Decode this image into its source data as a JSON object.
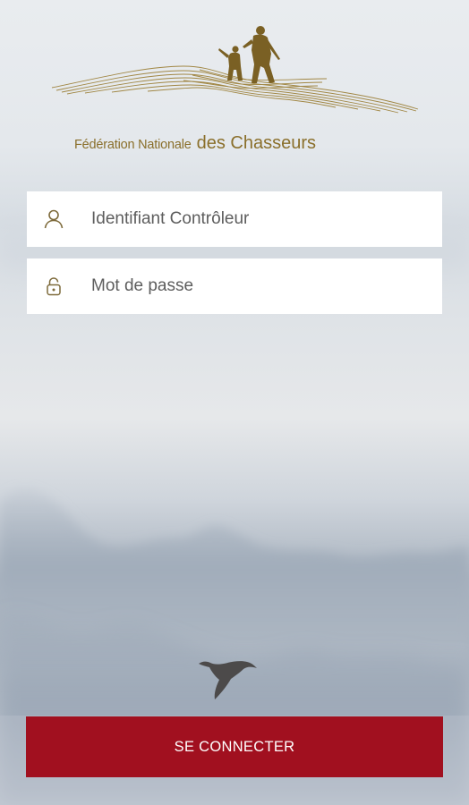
{
  "logo": {
    "text_small": "Fédération Nationale",
    "text_big": "des Chasseurs",
    "color": "#8a6f2b",
    "icon": "hunters-logo-icon"
  },
  "login_form": {
    "username": {
      "placeholder": "Identifiant Contrôleur",
      "value": "",
      "icon": "user-icon"
    },
    "password": {
      "placeholder": "Mot de passe",
      "value": "",
      "icon": "lock-icon"
    }
  },
  "submit_button": {
    "label": "SE CONNECTER",
    "color": "#a1101f"
  },
  "background": {
    "bird_icon": "flying-duck-icon"
  }
}
